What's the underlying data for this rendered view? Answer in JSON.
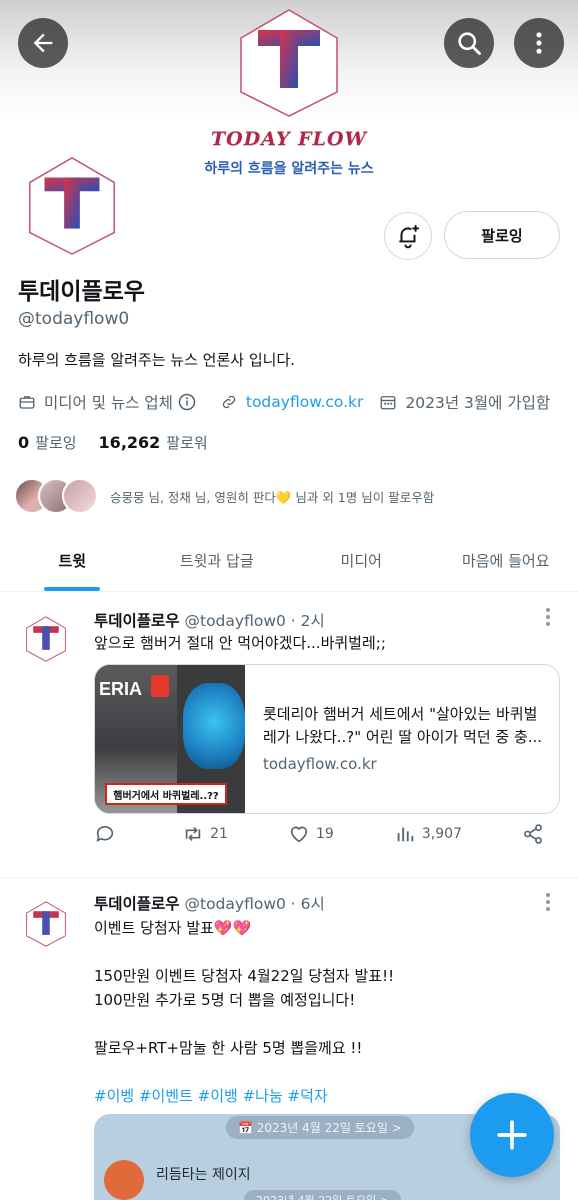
{
  "banner": {
    "logo_text": "TODAYFLOW",
    "brand": "TODAY FLOW",
    "tagline": "하루의 흐름을 알려주는 뉴스"
  },
  "profile": {
    "display_name": "투데이플로우",
    "handle": "@todayflow0",
    "bio": "하루의 흐름을 알려주는 뉴스 언론사 입니다.",
    "category": "미디어 및 뉴스 업체",
    "website": "todayflow.co.kr",
    "joined": "2023년 3월에 가입함",
    "following_count": "0",
    "following_label": "팔로잉",
    "followers_count": "16,262",
    "followers_label": "팔로워",
    "follow_button": "팔로잉",
    "followed_by": "승뭉뭉 님, 정채 님, 영원히 판다💛 님과 외 1명 님이 팔로우함"
  },
  "tabs": [
    {
      "label": "트윗",
      "active": true
    },
    {
      "label": "트윗과 답글",
      "active": false
    },
    {
      "label": "미디어",
      "active": false
    },
    {
      "label": "마음에 들어요",
      "active": false
    }
  ],
  "tweets": [
    {
      "name": "투데이플로우",
      "handle": "@todayflow0",
      "time": "· 2시",
      "text": "앞으로 햄버거 절대 안 먹어야겠다...바퀴벌레;;",
      "card": {
        "image_brand": "ERIA",
        "image_caption": "햄버거에서 바퀴벌레..??",
        "title": "롯데리아 햄버거 세트에서 \"살아있는 바퀴벌레가 나왔다..?\" 어린 딸 아이가 먹던 중 충...",
        "domain": "todayflow.co.kr"
      },
      "stats": {
        "replies": "",
        "retweets": "21",
        "likes": "19",
        "views": "3,907"
      }
    },
    {
      "name": "투데이플로우",
      "handle": "@todayflow0",
      "time": "· 6시",
      "line1": "이벤트 당첨자 발표💖💖",
      "line2": "150만원 이벤트 당첨자 4월22일 당첨자 발표!!",
      "line3": "100만원 추가로 5명 더 뽑을 예정입니다!",
      "line4": "팔로우+RT+맘눌 한 사람 5명 뽑을께요 !!",
      "hashtags": "#이벵 #이벤트 #이뱅 #나눔 #덕자",
      "embed": {
        "date": "📅 2023년 4월 22일 토요일 >",
        "name": "리듬타는 제이지",
        "date2": "2023년 4월 22일 토요일 >"
      }
    }
  ],
  "colors": {
    "accent": "#1d9bf0",
    "text": "#0f1419",
    "secondary": "#536471",
    "brand_red": "#b8234a"
  }
}
